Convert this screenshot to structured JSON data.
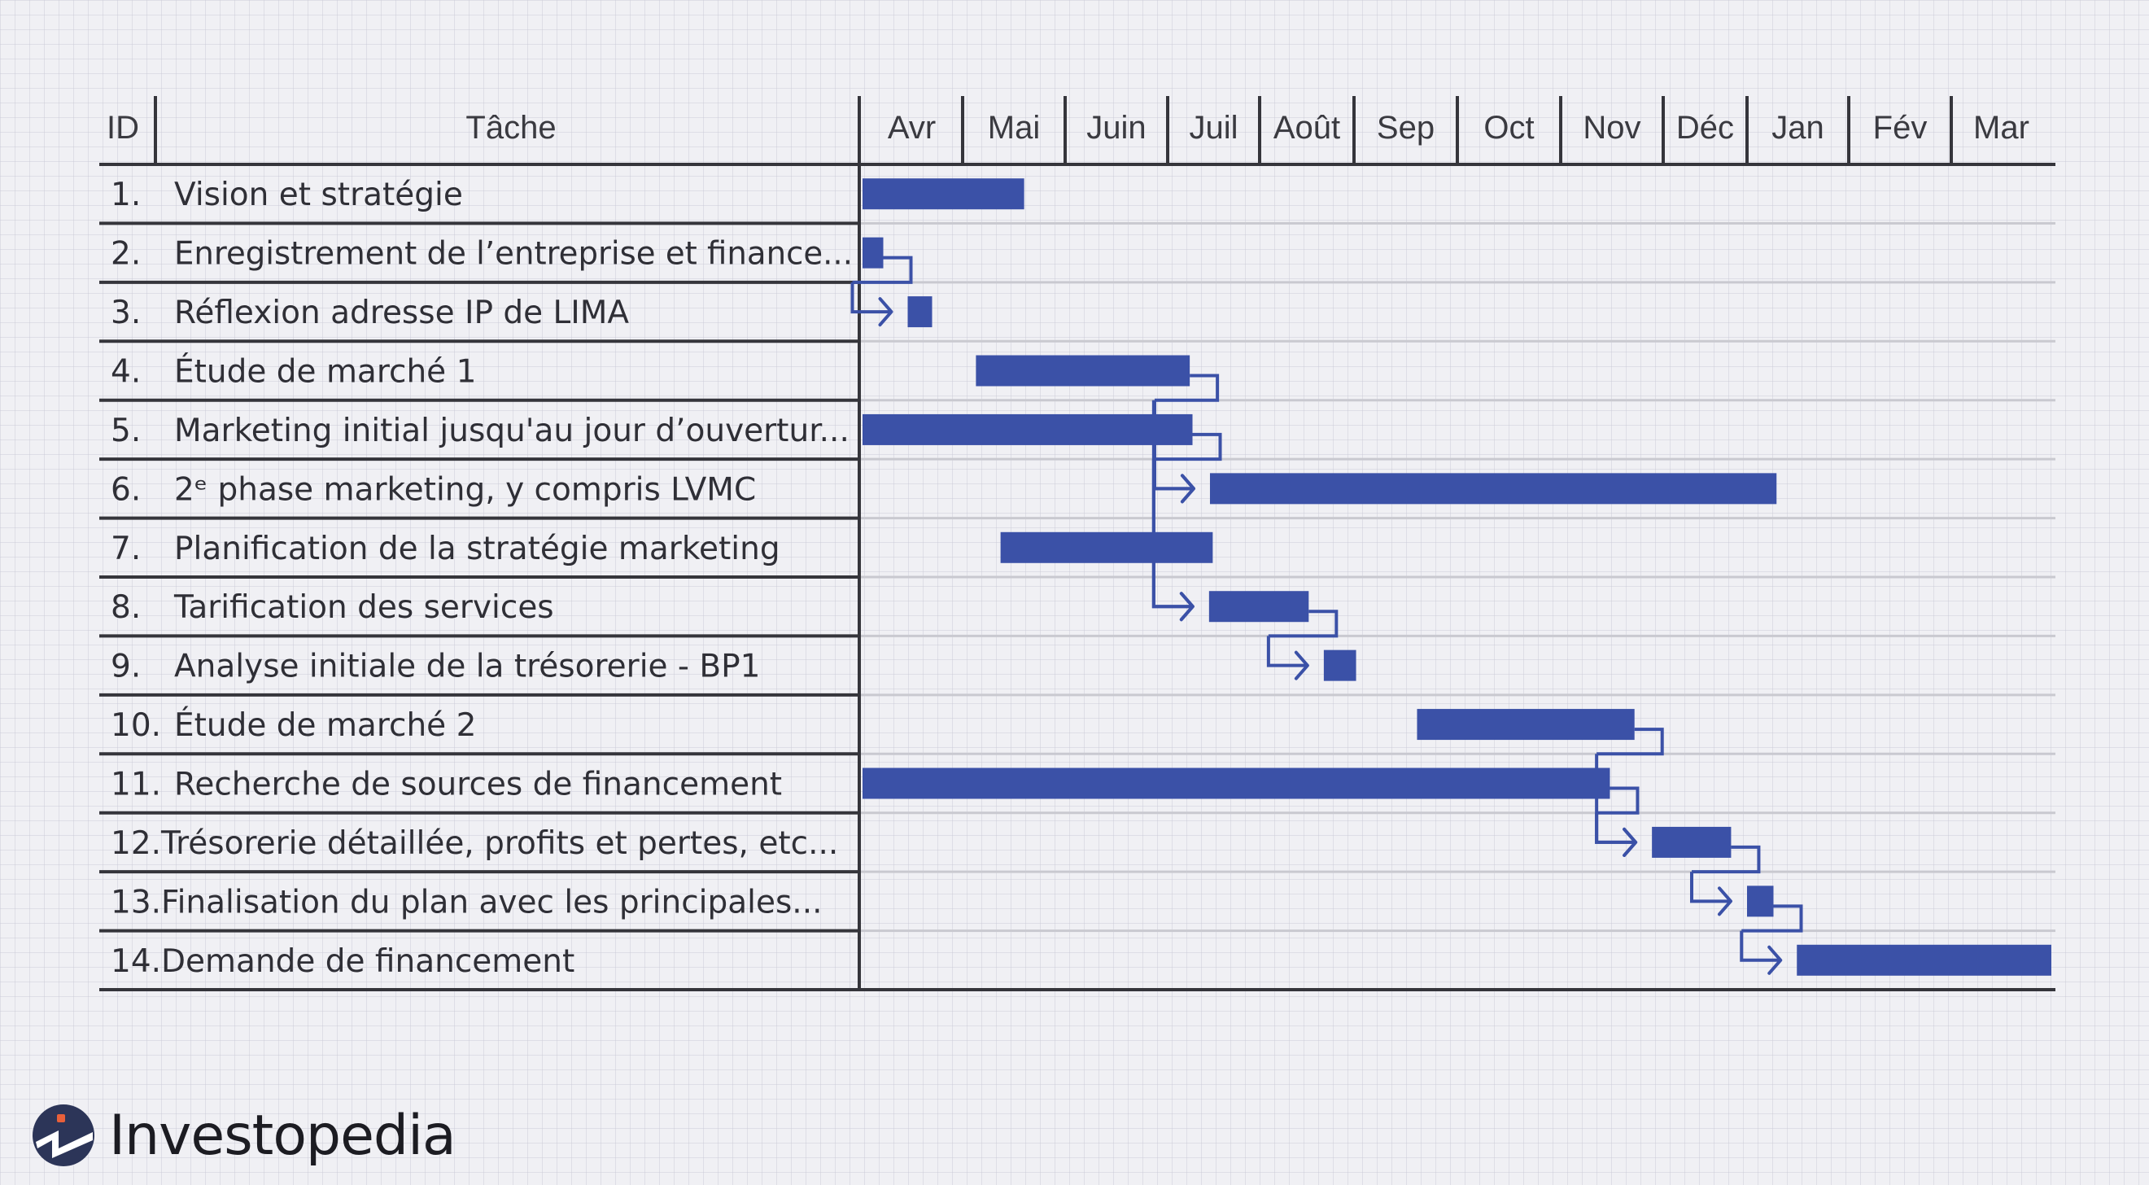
{
  "chart_data": {
    "type": "gantt",
    "title": "",
    "columns": {
      "id": "ID",
      "task": "Tâche"
    },
    "months": [
      "Avr",
      "Mai",
      "Juin",
      "Juil",
      "Août",
      "Sep",
      "Oct",
      "Nov",
      "Déc",
      "Jan",
      "Fév",
      "Mar"
    ],
    "x_unit": "months from start of Avr",
    "xlim": [
      0,
      12
    ],
    "bar_color": "#3b51a7",
    "tasks": [
      {
        "id": "1.",
        "name": "Vision et stratégie",
        "start": 0.0,
        "end": 1.6
      },
      {
        "id": "2.",
        "name": "Enregistrement de l’entreprise et finance...",
        "start": 0.0,
        "end": 0.22
      },
      {
        "id": "3.",
        "name": "Réflexion adresse IP de LIMA",
        "start": 0.46,
        "end": 0.7
      },
      {
        "id": "4.",
        "name": "Étude de marché 1",
        "start": 1.13,
        "end": 3.24
      },
      {
        "id": "5.",
        "name": "Marketing initial jusqu'au jour d’ouvertur...",
        "start": 0.0,
        "end": 3.27
      },
      {
        "id": "6.",
        "name": "2ᵉ phase marketing, y compris LVMC",
        "start": 3.46,
        "end": 9.29
      },
      {
        "id": "7.",
        "name": "Planification de la stratégie marketing",
        "start": 1.37,
        "end": 3.49
      },
      {
        "id": "8.",
        "name": "Tarification des services",
        "start": 3.45,
        "end": 4.52
      },
      {
        "id": "9.",
        "name": "Analyse initiale de la trésorerie - BP1",
        "start": 4.68,
        "end": 5.02
      },
      {
        "id": "10.",
        "name": "Étude de marché 2",
        "start": 5.61,
        "end": 7.72
      },
      {
        "id": "11.",
        "name": "Recherche de sources de financement",
        "start": 0.0,
        "end": 7.48
      },
      {
        "id": "12.",
        "name": "Trésorerie détaillée, profits et pertes, etc...",
        "start": 7.89,
        "end": 8.81
      },
      {
        "id": "13.",
        "name": "Finalisation du plan avec les principales...",
        "start": 9.0,
        "end": 9.26
      },
      {
        "id": "14.",
        "name": "Demande de financement",
        "start": 9.49,
        "end": 12.0
      }
    ],
    "dependencies": [
      {
        "from": 2,
        "to": 3
      },
      {
        "from": 4,
        "to": 6
      },
      {
        "from": 5,
        "to": 6
      },
      {
        "from": 4,
        "to": 8
      },
      {
        "from": 5,
        "to": 8
      },
      {
        "from": 8,
        "to": 9
      },
      {
        "from": 10,
        "to": 12
      },
      {
        "from": 11,
        "to": 12
      },
      {
        "from": 12,
        "to": 13
      },
      {
        "from": 13,
        "to": 14
      }
    ]
  },
  "branding": {
    "logo_name": "Investopedia",
    "logo_icon": "investopedia-logo-icon",
    "logo_colors": {
      "circle": "#2c3558",
      "dot": "#e8603a",
      "zigzag": "#ffffff"
    }
  }
}
